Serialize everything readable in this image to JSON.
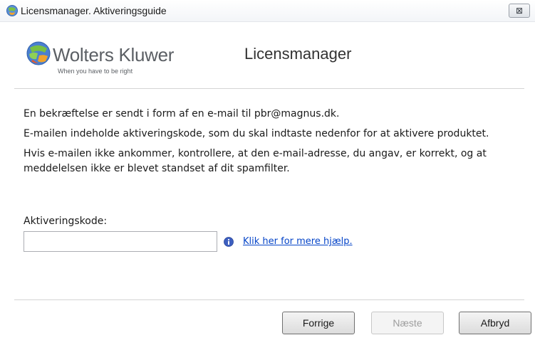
{
  "window": {
    "title": "Licensmanager. Aktiveringsguide",
    "close_glyph": "⊠"
  },
  "header": {
    "brand": "Wolters Kluwer",
    "tagline": "When you have to be right",
    "product_title": "Licensmanager"
  },
  "content": {
    "paragraph1": "En bekræftelse er sendt i form af en e-mail til pbr@magnus.dk.",
    "paragraph2": "E-mailen indeholde aktiveringskode, som du skal indtaste nedenfor for at aktivere produktet.",
    "paragraph3": "Hvis e-mailen ikke ankommer, kontrollere, at den e-mail-adresse, du angav, er korrekt, og at meddelelsen ikke er blevet standset af dit spamfilter."
  },
  "activation": {
    "label": "Aktiveringskode:",
    "value": "",
    "help_link": "Klik her for mere hjælp."
  },
  "buttons": {
    "previous": "Forrige",
    "next": "Næste",
    "cancel": "Afbryd"
  },
  "icons": {
    "app": "app-globe-icon",
    "logo": "wolters-kluwer-globe-icon",
    "info": "info-icon",
    "close": "close-icon"
  },
  "colors": {
    "link": "#0645c8",
    "disabled_text": "#9d9d9d",
    "info_blue": "#3d5fbf"
  }
}
